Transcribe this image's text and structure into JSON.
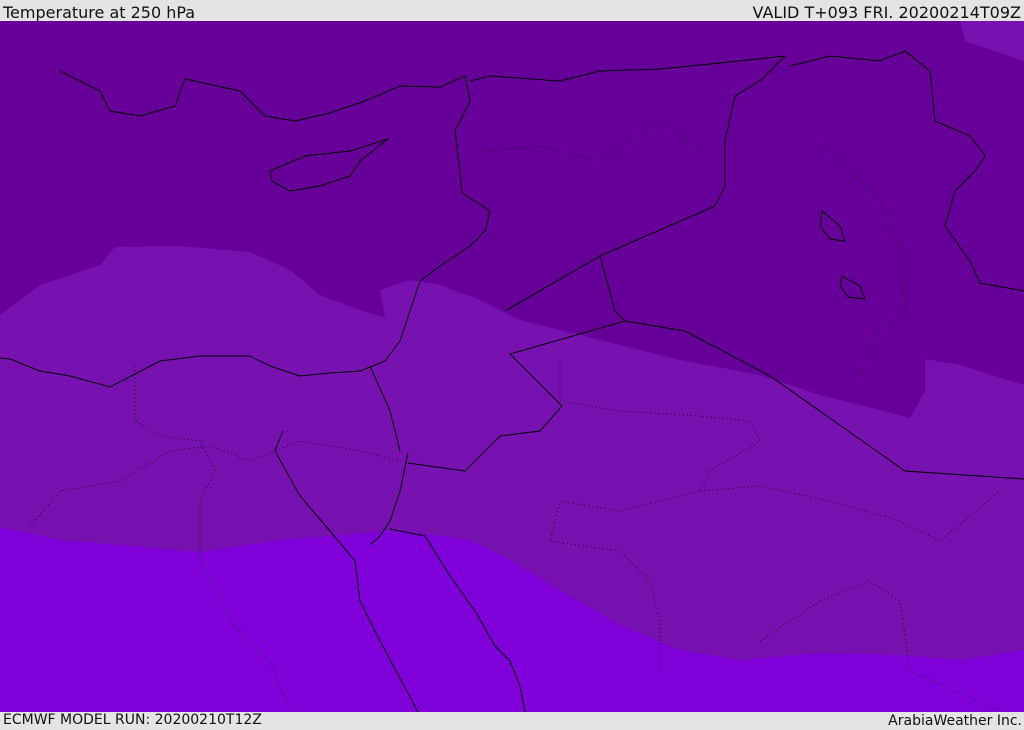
{
  "header": {
    "title": "Temperature at 250 hPa",
    "valid": "VALID T+093 FRI. 20200214T09Z"
  },
  "footer": {
    "model_run": "ECMWF MODEL RUN: 20200210T12Z",
    "credit": "ArabiaWeather Inc."
  },
  "colors": {
    "cold_band": "#660099",
    "mid_band": "#7711b0",
    "warm_band": "#7f00d9",
    "coastline": "#000000"
  }
}
